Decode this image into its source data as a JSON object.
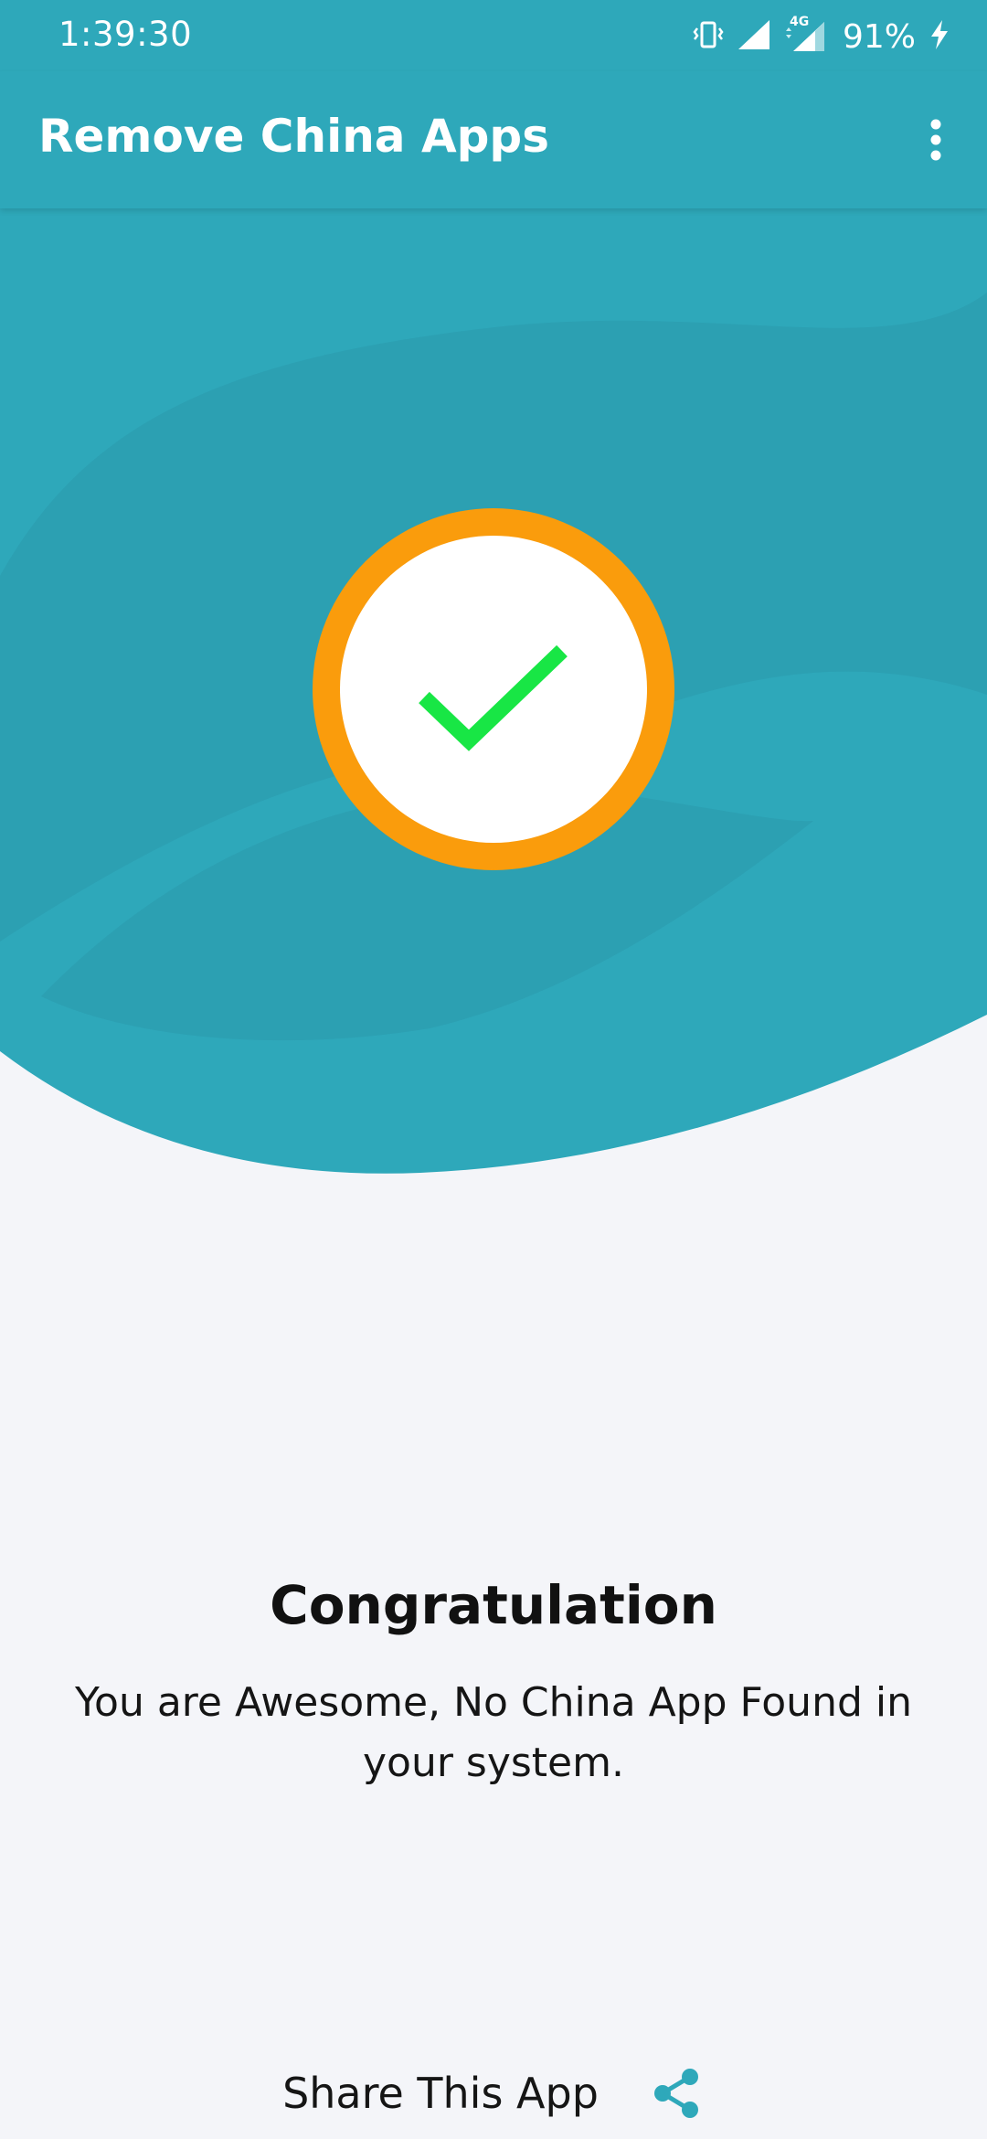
{
  "status_bar": {
    "time": "1:39:30",
    "network_label": "4G",
    "battery": "91%"
  },
  "app_bar": {
    "title": "Remove China Apps",
    "menu_icon": "more-vert-icon"
  },
  "result": {
    "icon": "check-circle-icon",
    "heading": "Congratulation",
    "message": "You are Awesome, No China App Found in your system."
  },
  "share": {
    "label": "Share This App",
    "icon": "share-icon"
  },
  "colors": {
    "primary": "#2ea8ba",
    "primary_dark": "#2b9db0",
    "accent_orange": "#fa9c0c",
    "check_green": "#18e645",
    "background": "#f4f5f9"
  }
}
